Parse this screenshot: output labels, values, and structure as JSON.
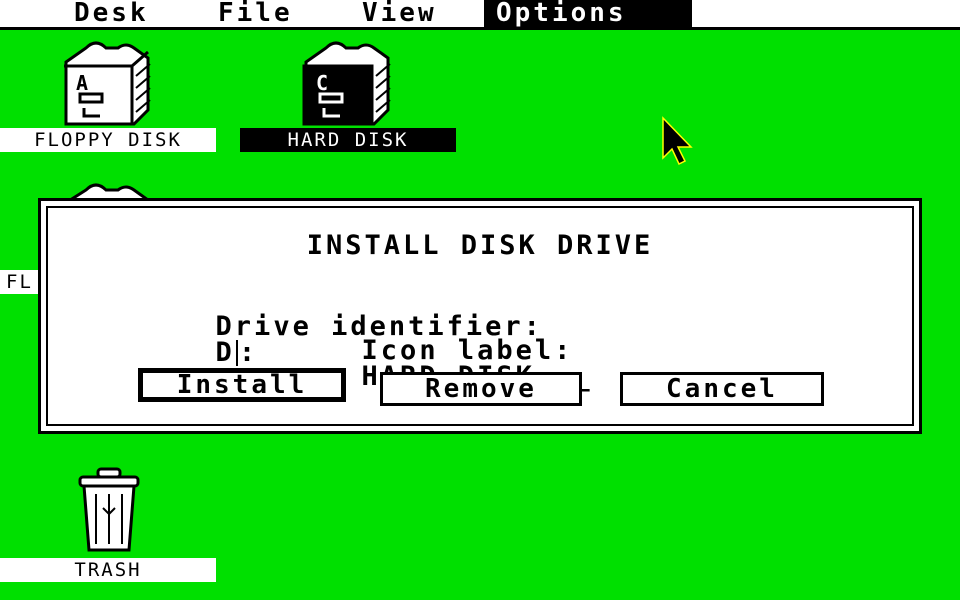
{
  "menubar": {
    "items": [
      {
        "label": "Desk"
      },
      {
        "label": "File"
      },
      {
        "label": "View"
      },
      {
        "label": "Options"
      }
    ]
  },
  "desktop": {
    "icons": [
      {
        "label": "FLOPPY DISK",
        "letter": "A"
      },
      {
        "label": "HARD DISK",
        "letter": "C"
      },
      {
        "label": "FL"
      },
      {
        "label": "TRASH"
      }
    ]
  },
  "dialog": {
    "title": "INSTALL DISK DRIVE",
    "drive_identifier_label": "Drive identifier:",
    "drive_identifier_value": "D",
    "drive_identifier_suffix": ":",
    "icon_label_label": "Icon label:",
    "icon_label_value": "HARD DISK___",
    "buttons": {
      "install": "Install",
      "remove": "Remove",
      "cancel": "Cancel"
    }
  },
  "colors": {
    "desktop": "#00e000",
    "menubar": "#ffffff",
    "foreground": "#000000"
  }
}
